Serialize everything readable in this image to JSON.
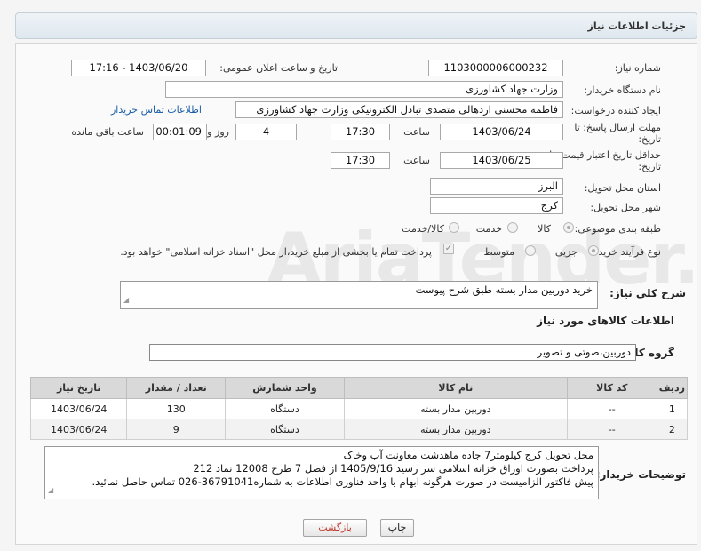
{
  "header": {
    "title": "جزئیات اطلاعات نیاز"
  },
  "fields": {
    "need_number_label": "شماره نیاز:",
    "need_number": "1103000006000232",
    "announce_label": "تاریخ و ساعت اعلان عمومی:",
    "announce_value": "1403/06/20 - 17:16",
    "buyer_org_label": "نام دستگاه خریدار:",
    "buyer_org": "وزارت جهاد کشاورزی",
    "creator_label": "ایجاد کننده درخواست:",
    "creator": "فاطمه محسنی اردهالی متصدی تبادل الکترونیکی وزارت جهاد کشاورزی",
    "contact_link": "اطلاعات تماس خریدار",
    "deadline_label_1": "مهلت ارسال پاسخ: تا",
    "deadline_label_2": "تاریخ:",
    "deadline_date": "1403/06/24",
    "time_label": "ساعت",
    "deadline_time": "17:30",
    "days_value": "4",
    "days_label": "روز و",
    "remaining_value": "00:01:09",
    "remaining_label": "ساعت باقی مانده",
    "validity_label_1": "حداقل تاریخ اعتبار قیمت: تا",
    "validity_label_2": "تاریخ:",
    "validity_date": "1403/06/25",
    "validity_time": "17:30",
    "province_label": "استان محل تحویل:",
    "province": "البرز",
    "city_label": "شهر محل تحویل:",
    "city": "کرج",
    "category_label": "طبقه بندی موضوعی:",
    "category_options": [
      "کالا",
      "خدمت",
      "کالا/خدمت"
    ],
    "purchase_type_label": "نوع فرآیند خرید :",
    "purchase_options": [
      "جزیی",
      "متوسط"
    ],
    "payment_note": "پرداخت تمام یا بخشی از مبلغ خرید،از محل \"اسناد خزانه اسلامی\" خواهد بود."
  },
  "description": {
    "label": "شرح کلی نیاز:",
    "text": "خرید دوربین مدار بسته طبق شرح پیوست"
  },
  "goods_section": {
    "title": "اطلاعات کالاهای مورد نیاز",
    "group_label": "گروه کالا:",
    "group_value": "دوربین،صوتی و تصویر"
  },
  "table": {
    "headers": [
      "ردیف",
      "کد کالا",
      "نام کالا",
      "واحد شمارش",
      "تعداد / مقدار",
      "تاریخ نیاز"
    ],
    "rows": [
      [
        "1",
        "--",
        "دوربین مدار بسته",
        "دستگاه",
        "130",
        "1403/06/24"
      ],
      [
        "2",
        "--",
        "دوربین مدار بسته",
        "دستگاه",
        "9",
        "1403/06/24"
      ]
    ]
  },
  "buyer_notes": {
    "label": "توضیحات خریدار:",
    "lines": [
      "محل تحویل کرج کیلومتر7 جاده ماهدشت معاونت آب وخاک",
      "پرداخت بصورت اوراق خزانه اسلامی سر رسید 1405/9/16 از فصل 7 طرح 12008 نماد 212",
      "پیش فاکتور الزامیست در صورت هرگونه ابهام  با واحد فناوری اطلاعات به شماره36791041-026 تماس حاصل نمائید."
    ]
  },
  "buttons": {
    "print": "چاپ",
    "back": "بازگشت"
  },
  "watermark": "AriaTender.neT"
}
